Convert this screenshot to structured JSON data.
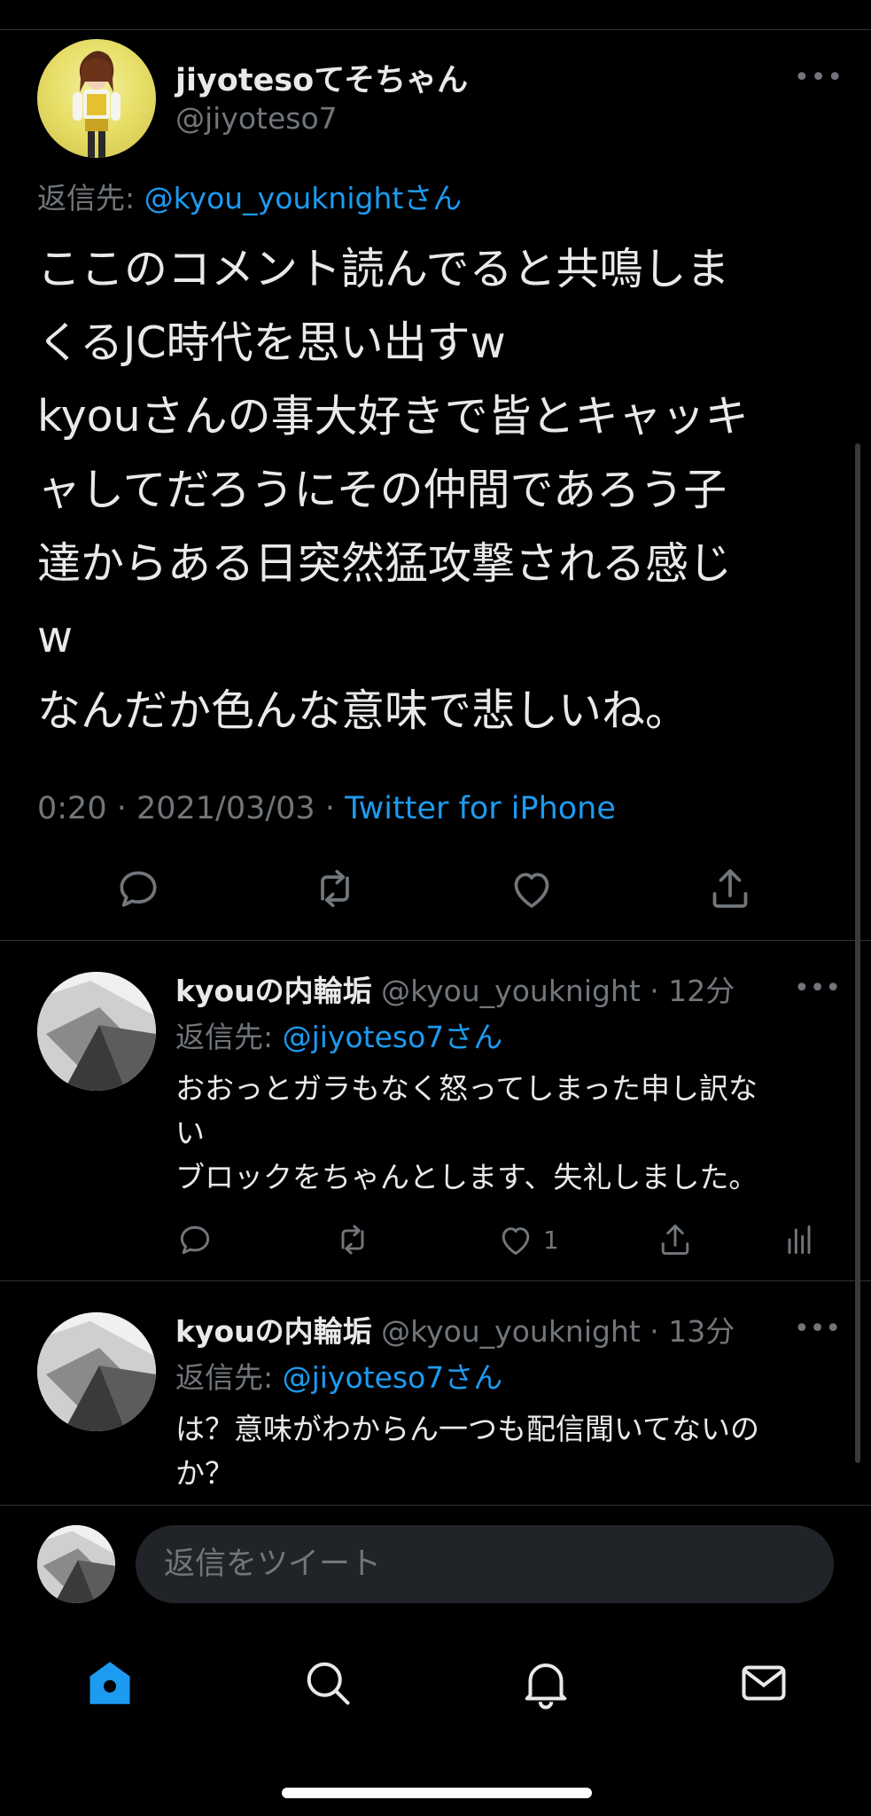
{
  "main_tweet": {
    "display_name": "jiyotesoてそちゃん",
    "handle": "@jiyoteso7",
    "more": "•••",
    "reply_label": "返信先: ",
    "reply_target": "@kyou_youknightさん",
    "text": "ここのコメント読んでると共鳴しま\nくるJC時代を思い出すw\nkyouさんの事大好きで皆とキャッキ\nャしてだろうにその仲間であろう子\n達からある日突然猛攻撃される感じ\nw\nなんだか色んな意味で悲しいね。",
    "time_date": "0:20 · 2021/03/03 · ",
    "source": "Twitter for iPhone"
  },
  "replies": [
    {
      "display_name": "kyouの内輪垢",
      "meta": " @kyou_youknight · 12分",
      "more": "•••",
      "reply_label": "返信先: ",
      "reply_target": "@jiyoteso7さん",
      "text": "おおっとガラもなく怒ってしまった申し訳な\nい\nブロックをちゃんとします、失礼しました。",
      "like_count": "1"
    },
    {
      "display_name": "kyouの内輪垢",
      "meta": " @kyou_youknight · 13分",
      "more": "•••",
      "reply_label": "返信先: ",
      "reply_target": "@jiyoteso7さん",
      "text": "は？意味がわからん一つも配信聞いてないの\nか？"
    }
  ],
  "composer": {
    "placeholder": "返信をツイート"
  },
  "icons": {
    "reply": "reply-icon",
    "retweet": "retweet-icon",
    "like": "like-icon",
    "share": "share-icon",
    "analytics": "analytics-icon",
    "home": "home-icon",
    "search": "search-icon",
    "notifications": "bell-icon",
    "messages": "mail-icon"
  },
  "colors": {
    "background": "#000000",
    "text": "#e7e9ea",
    "secondary": "#71767b",
    "accent": "#1d9bf0",
    "divider": "#2f3336"
  }
}
